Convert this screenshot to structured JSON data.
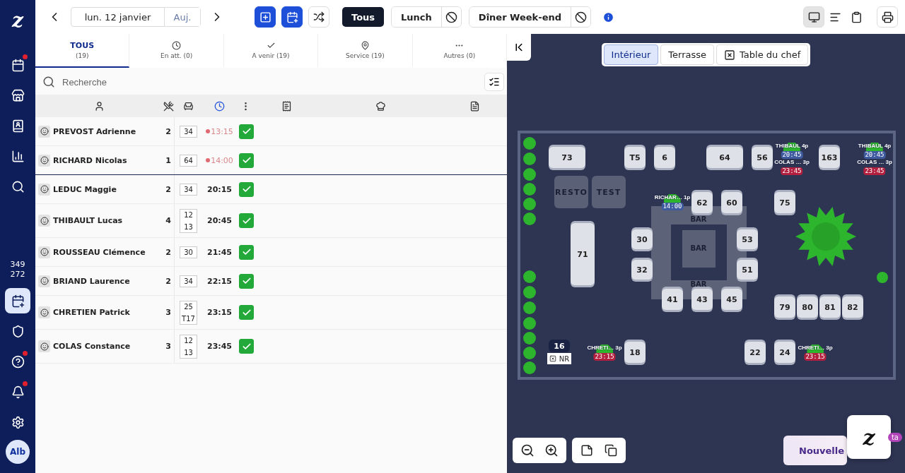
{
  "sidebar": {
    "logo": "z",
    "items": [
      {
        "kind": "calendar",
        "selected": false,
        "notification": true
      },
      {
        "kind": "register",
        "selected": false,
        "notification": false
      },
      {
        "kind": "contacts",
        "selected": false,
        "notification": false
      },
      {
        "kind": "chart",
        "selected": false,
        "notification": false
      },
      {
        "kind": "search",
        "selected": false,
        "notification": false
      }
    ],
    "counts": [
      "349",
      "272"
    ],
    "bottom_items": [
      {
        "kind": "calendar-add",
        "selected": true,
        "notification": false
      },
      {
        "kind": "shield",
        "selected": false,
        "notification": false
      },
      {
        "kind": "help",
        "selected": false,
        "notification": true
      },
      {
        "kind": "bell",
        "selected": false,
        "notification": true
      },
      {
        "kind": "settings",
        "selected": false,
        "notification": false
      }
    ],
    "avatar": "Alb"
  },
  "toolbar": {
    "date": "lun. 12 janvier",
    "today": "Auj.",
    "actions": [
      {
        "kind": "table-add"
      },
      {
        "kind": "calendar-add"
      },
      {
        "kind": "shuffle"
      }
    ],
    "filters": [
      {
        "label": "Tous",
        "kind": "all",
        "selected": true
      },
      {
        "label": "Lunch",
        "kind": "service",
        "selected": false
      },
      {
        "label": "Dîner Week-end",
        "kind": "service",
        "selected": false
      }
    ],
    "views": [
      {
        "kind": "floor",
        "selected": true
      },
      {
        "kind": "timeline",
        "selected": false
      },
      {
        "kind": "list",
        "selected": false
      }
    ]
  },
  "tabs": [
    {
      "label": "TOUS",
      "count": "(19)",
      "kind": "all",
      "selected": true
    },
    {
      "label": "En att. (0)",
      "kind": "waiting",
      "selected": false
    },
    {
      "label": "A venir (19)",
      "kind": "upcoming",
      "selected": false
    },
    {
      "label": "Service (19)",
      "kind": "service",
      "selected": false
    },
    {
      "label": "Autres (0)",
      "kind": "other",
      "selected": false
    }
  ],
  "search": {
    "placeholder": "Recherche"
  },
  "rows": [
    {
      "name": "PREVOST Adrienne",
      "covers": "2",
      "tables": [
        "34"
      ],
      "time": "13:15",
      "late": true,
      "checked": true
    },
    {
      "name": "RICHARD Nicolas",
      "covers": "1",
      "tables": [
        "64"
      ],
      "time": "14:00",
      "late": true,
      "checked": true
    },
    {
      "name": "LEDUC Maggie",
      "covers": "2",
      "tables": [
        "34"
      ],
      "time": "20:15",
      "late": false,
      "checked": true
    },
    {
      "name": "THIBAULT Lucas",
      "covers": "4",
      "tables": [
        "12",
        "13"
      ],
      "time": "20:45",
      "late": false,
      "checked": true
    },
    {
      "name": "ROUSSEAU Clémence",
      "covers": "2",
      "tables": [
        "30"
      ],
      "time": "21:45",
      "late": false,
      "checked": true
    },
    {
      "name": "BRIAND Laurence",
      "covers": "2",
      "tables": [
        "34"
      ],
      "time": "22:15",
      "late": false,
      "checked": true
    },
    {
      "name": "CHRETIEN Patrick",
      "covers": "3",
      "tables": [
        "25",
        "T17"
      ],
      "time": "23:15",
      "late": false,
      "checked": true
    },
    {
      "name": "COLAS Constance",
      "covers": "3",
      "tables": [
        "12",
        "13"
      ],
      "time": "23:45",
      "late": false,
      "checked": true
    }
  ],
  "floor": {
    "rooms": [
      {
        "label": "Intérieur",
        "selected": true
      },
      {
        "label": "Terrasse",
        "selected": false
      },
      {
        "label": "Table du chef",
        "selected": false,
        "kind": "chef"
      }
    ],
    "tables": [
      {
        "label": "73",
        "kind": "table"
      },
      {
        "label": "T5",
        "kind": "table"
      },
      {
        "label": "6",
        "kind": "table"
      },
      {
        "label": "64",
        "kind": "table"
      },
      {
        "label": "56",
        "kind": "table"
      },
      {
        "label": "163",
        "kind": "table"
      },
      {
        "label": "RESTO",
        "kind": "zone"
      },
      {
        "label": "TEST",
        "kind": "zone"
      },
      {
        "label": "62",
        "kind": "table"
      },
      {
        "label": "60",
        "kind": "table"
      },
      {
        "label": "75",
        "kind": "table"
      },
      {
        "label": "71",
        "kind": "table"
      },
      {
        "label": "30",
        "kind": "table"
      },
      {
        "label": "53",
        "kind": "table"
      },
      {
        "label": "32",
        "kind": "table"
      },
      {
        "label": "51",
        "kind": "table"
      },
      {
        "label": "41",
        "kind": "table"
      },
      {
        "label": "43",
        "kind": "table"
      },
      {
        "label": "45",
        "kind": "table"
      },
      {
        "label": "79",
        "kind": "table"
      },
      {
        "label": "80",
        "kind": "table"
      },
      {
        "label": "81",
        "kind": "table"
      },
      {
        "label": "82",
        "kind": "table"
      },
      {
        "label": "16",
        "kind": "blocked",
        "tag": "NR"
      },
      {
        "label": "18",
        "kind": "table"
      },
      {
        "label": "22",
        "kind": "table"
      },
      {
        "label": "24",
        "kind": "table"
      }
    ],
    "bar_labels": [
      "BAR",
      "BAR",
      "BAR"
    ],
    "reservations": [
      {
        "name": "THIBAUL",
        "covers": "4p",
        "time": "20:45",
        "color": "#3f5ba0"
      },
      {
        "name": "COLAS …",
        "covers": "3p",
        "time": "23:45",
        "color": "#b3203f"
      },
      {
        "name": "THIBAUL",
        "covers": "4p",
        "time": "20:45",
        "color": "#3f5ba0"
      },
      {
        "name": "COLAS …",
        "covers": "3p",
        "time": "23:45",
        "color": "#b3203f"
      },
      {
        "name": "RICHAR…",
        "covers": "1p",
        "time": "14:00",
        "color": "#3f5ba0"
      },
      {
        "name": "CHRETI…",
        "covers": "3p",
        "time": "23:15",
        "color": "#b3203f"
      },
      {
        "name": "CHRETI…",
        "covers": "3p",
        "time": "23:15",
        "color": "#b3203f"
      }
    ],
    "new_button": {
      "label": "Nouvelle",
      "badge": "ta"
    },
    "logo": "z"
  }
}
